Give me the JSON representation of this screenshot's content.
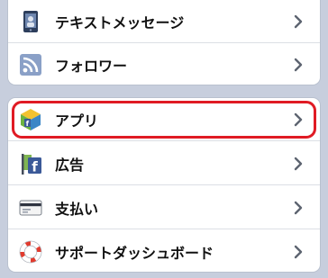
{
  "settings_top": [
    {
      "label": "テキストメッセージ",
      "icon": "phone-sms-icon"
    },
    {
      "label": "フォロワー",
      "icon": "rss-feed-icon"
    }
  ],
  "settings_bottom": [
    {
      "label": "アプリ",
      "icon": "app-cube-icon",
      "highlighted": true
    },
    {
      "label": "広告",
      "icon": "ads-flag-icon"
    },
    {
      "label": "支払い",
      "icon": "credit-card-icon"
    },
    {
      "label": "サポートダッシュボード",
      "icon": "lifebuoy-icon"
    }
  ],
  "colors": {
    "background": "#c7cedd",
    "highlight": "#e01b24",
    "facebook_blue": "#3b5998"
  }
}
